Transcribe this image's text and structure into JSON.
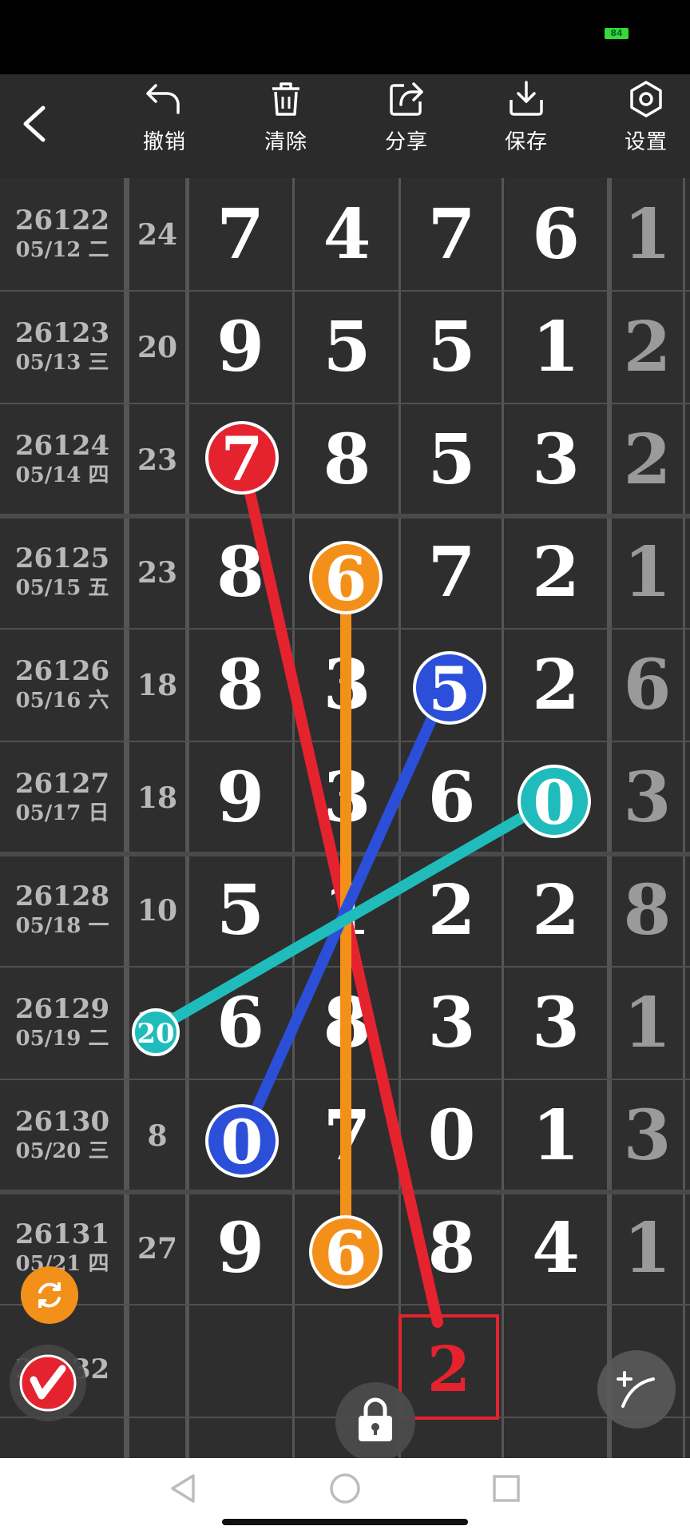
{
  "status_bar": {
    "battery": "84"
  },
  "toolbar": {
    "back_icon": "chevron-left-icon",
    "items": [
      {
        "label": "撤销",
        "icon": "undo-icon"
      },
      {
        "label": "清除",
        "icon": "trash-icon"
      },
      {
        "label": "分享",
        "icon": "share-icon"
      },
      {
        "label": "保存",
        "icon": "download-icon"
      },
      {
        "label": "设置",
        "icon": "settings-hexagon-icon"
      }
    ]
  },
  "rows": [
    {
      "issue": "26122",
      "date": "05/12 二",
      "sum": "24",
      "digits": [
        "7",
        "4",
        "7",
        "6"
      ],
      "last": "1"
    },
    {
      "issue": "26123",
      "date": "05/13 三",
      "sum": "20",
      "digits": [
        "9",
        "5",
        "5",
        "1"
      ],
      "last": "2"
    },
    {
      "issue": "26124",
      "date": "05/14 四",
      "sum": "23",
      "digits": [
        "7",
        "8",
        "5",
        "3"
      ],
      "last": "2"
    },
    {
      "issue": "26125",
      "date": "05/15 五",
      "sum": "23",
      "digits": [
        "8",
        "6",
        "7",
        "2"
      ],
      "last": "1"
    },
    {
      "issue": "26126",
      "date": "05/16 六",
      "sum": "18",
      "digits": [
        "8",
        "3",
        "5",
        "2"
      ],
      "last": "6"
    },
    {
      "issue": "26127",
      "date": "05/17 日",
      "sum": "18",
      "digits": [
        "9",
        "3",
        "6",
        "0"
      ],
      "last": "3"
    },
    {
      "issue": "26128",
      "date": "05/18 一",
      "sum": "10",
      "digits": [
        "5",
        "1",
        "2",
        "2"
      ],
      "last": "8"
    },
    {
      "issue": "26129",
      "date": "05/19 二",
      "sum": "20",
      "digits": [
        "6",
        "8",
        "3",
        "3"
      ],
      "last": "1"
    },
    {
      "issue": "26130",
      "date": "05/20 三",
      "sum": "8",
      "digits": [
        "0",
        "7",
        "0",
        "1"
      ],
      "last": "3"
    },
    {
      "issue": "26131",
      "date": "05/21 四",
      "sum": "27",
      "digits": [
        "9",
        "6",
        "8",
        "4"
      ],
      "last": "1"
    }
  ],
  "partial_row": {
    "issue": "26132",
    "predicted": "2"
  },
  "markers": {
    "red_top": "7",
    "orange_top": "6",
    "orange_bottom": "6",
    "blue_top": "5",
    "blue_bottom": "0",
    "teal_right": "0",
    "teal_left": "20",
    "cross_digit": "1"
  },
  "colors": {
    "red": "#e5232f",
    "orange": "#f3901a",
    "blue": "#2b4fd8",
    "teal": "#20bcbc",
    "predicted": "#e5232f"
  },
  "floating": {
    "refresh_icon": "refresh-icon",
    "logo_icon": "app-logo-icon",
    "lock_icon": "lock-icon",
    "curve_tool_icon": "add-curve-icon"
  },
  "nav": {
    "back": "back-triangle-icon",
    "home": "home-circle-icon",
    "recent": "recent-square-icon"
  }
}
